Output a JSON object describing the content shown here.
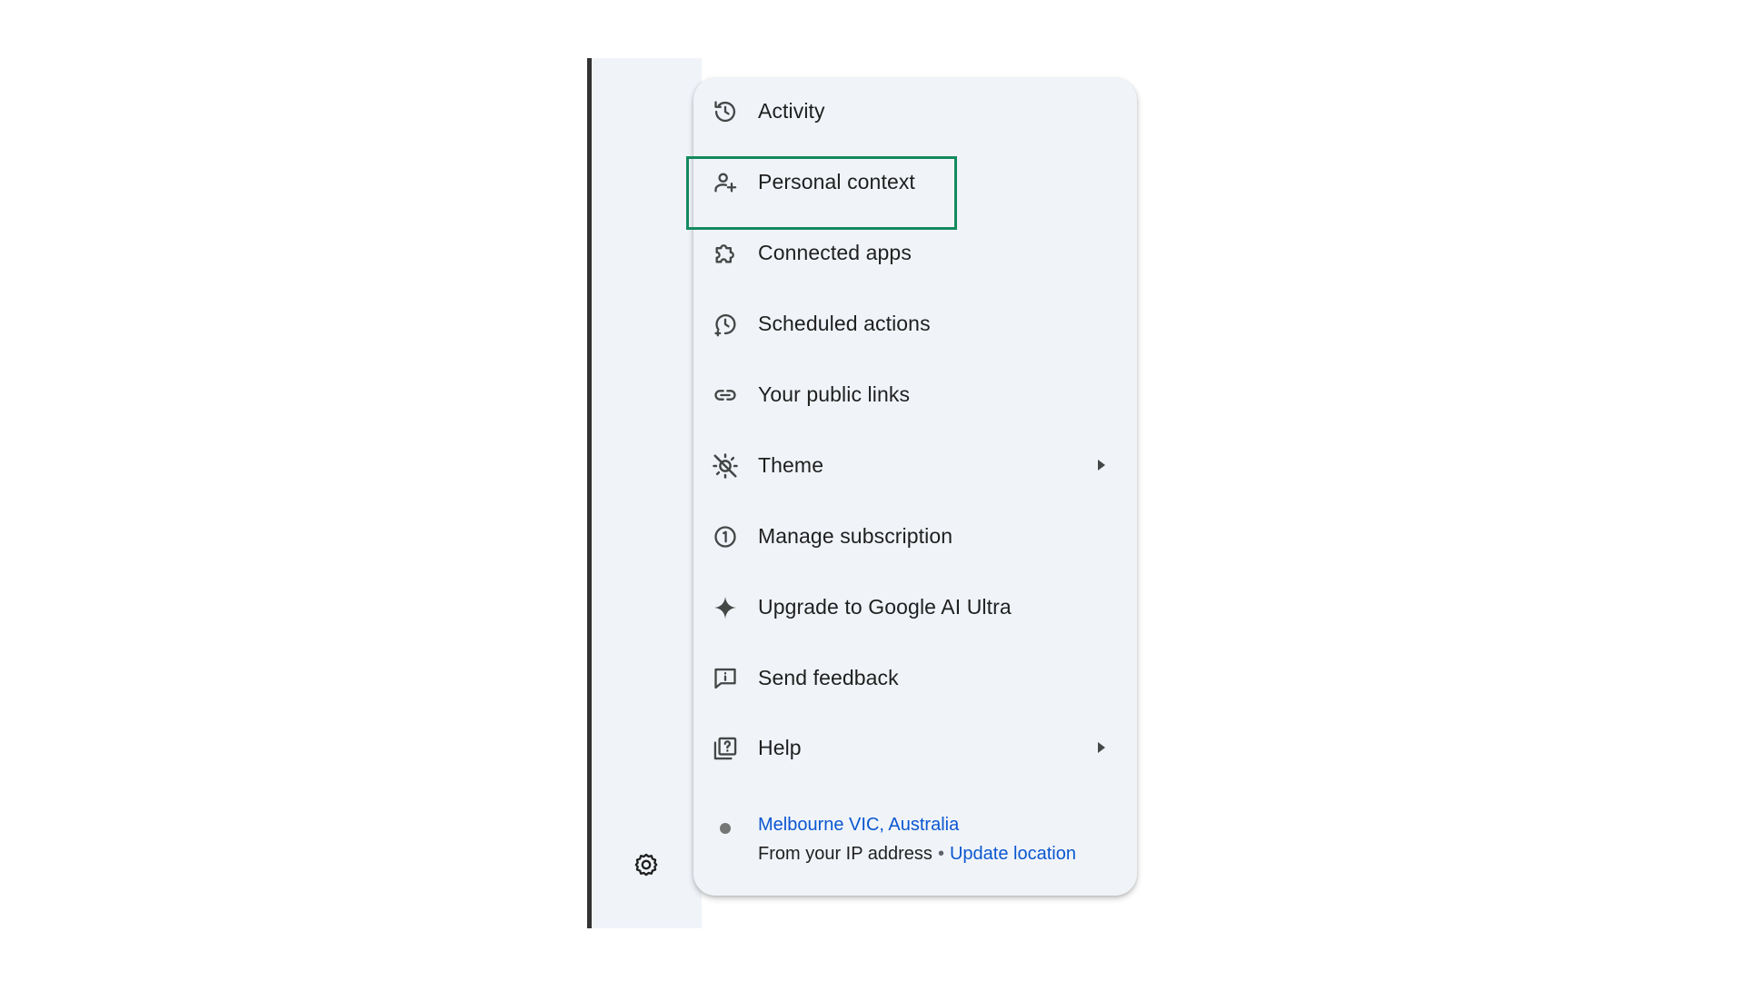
{
  "menu": {
    "items": [
      {
        "label": "Activity",
        "icon": "history-icon"
      },
      {
        "label": "Personal context",
        "icon": "person-sparkle-icon",
        "highlighted": true
      },
      {
        "label": "Connected apps",
        "icon": "puzzle-icon"
      },
      {
        "label": "Scheduled actions",
        "icon": "schedule-sparkle-icon"
      },
      {
        "label": "Your public links",
        "icon": "link-icon"
      },
      {
        "label": "Theme",
        "icon": "theme-icon",
        "submenu": true
      },
      {
        "label": "Manage subscription",
        "icon": "subscription-icon"
      },
      {
        "label": "Upgrade to Google AI Ultra",
        "icon": "sparkle-icon"
      },
      {
        "label": "Send feedback",
        "icon": "feedback-icon"
      },
      {
        "label": "Help",
        "icon": "help-icon",
        "submenu": true
      }
    ],
    "location": {
      "name": "Melbourne VIC, Australia",
      "source": "From your IP address",
      "separator": "•",
      "update_label": "Update location"
    }
  },
  "rail": {
    "settings_icon": "gear-icon"
  },
  "colors": {
    "menu_bg": "#f0f4f9",
    "highlight_border": "#138a5e",
    "link": "#0b57d0",
    "text": "#1f1f1f",
    "icon": "#444746"
  }
}
